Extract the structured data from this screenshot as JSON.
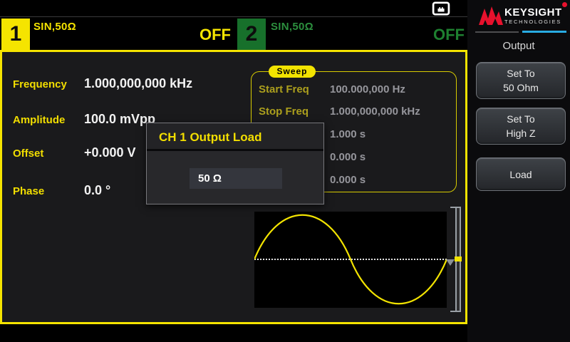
{
  "status": {
    "network_icon": "lan"
  },
  "channels": [
    {
      "number": "1",
      "waveform": "SIN,50Ω",
      "state": "OFF"
    },
    {
      "number": "2",
      "waveform": "SIN,50Ω",
      "state": "OFF"
    }
  ],
  "parameters": [
    {
      "label": "Frequency",
      "value": "1.000,000,000 kHz"
    },
    {
      "label": "Amplitude",
      "value": "100.0 mVpp"
    },
    {
      "label": "Offset",
      "value": "+0.000 V"
    },
    {
      "label": "Phase",
      "value": "0.0 °"
    }
  ],
  "sweep": {
    "badge": "Sweep",
    "rows": [
      {
        "label": "Start Freq",
        "value": "100.000,000 Hz"
      },
      {
        "label": "Stop Freq",
        "value": "1.000,000,000 kHz"
      },
      {
        "label": "",
        "value": "1.000 s"
      },
      {
        "label": "",
        "value": "0.000 s"
      },
      {
        "label": "",
        "value": "0.000 s"
      }
    ]
  },
  "waveform_display": {
    "shape": "sine",
    "cycles": 1
  },
  "dialog": {
    "title": "CH 1 Output Load",
    "value": "50 Ω"
  },
  "sidebar": {
    "brand": "KEYSIGHT",
    "brand_sub": "TECHNOLOGIES",
    "section": "Output",
    "buttons": [
      {
        "line1": "Set To",
        "line2": "50 Ohm"
      },
      {
        "line1": "Set To",
        "line2": "High Z"
      },
      {
        "line1": "Load",
        "line2": ""
      }
    ]
  },
  "colors": {
    "accent_yellow": "#f5e400",
    "ch2_green": "#17702b",
    "value_white": "#f2f2f2",
    "sweep_value_gray": "#96969c",
    "brand_red": "#e8112d",
    "brand_cyan": "#29abe2"
  }
}
